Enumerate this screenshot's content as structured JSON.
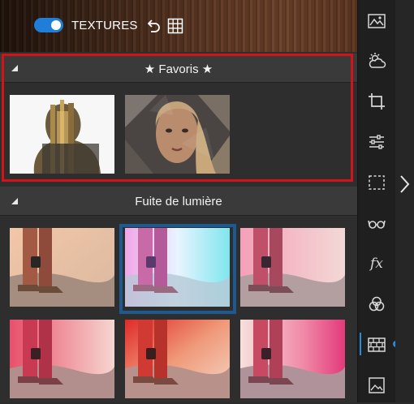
{
  "header": {
    "toggle_on": true,
    "title": "TEXTURES",
    "icons": [
      "undo-icon",
      "grid-icon"
    ]
  },
  "sections": {
    "favorites": {
      "title": "★ Favoris ★",
      "items": [
        {
          "name": "double-exposure-forest-man"
        },
        {
          "name": "geometric-triangle-portrait"
        }
      ]
    },
    "light_leak": {
      "title": "Fuite de lumière",
      "items": [
        {
          "name": "light-leak-warm-peach"
        },
        {
          "name": "light-leak-cyan-magenta",
          "selected": true
        },
        {
          "name": "light-leak-pink-haze"
        },
        {
          "name": "light-leak-red-pink"
        },
        {
          "name": "light-leak-red-orange"
        },
        {
          "name": "light-leak-magenta-pink"
        }
      ]
    }
  },
  "toolbar": {
    "tools": [
      "landscape-photo-icon",
      "weather-sun-cloud-icon",
      "crop-icon",
      "adjust-sliders-icon",
      "selection-marquee-icon",
      "glasses-icon",
      "fx-icon",
      "color-circles-icon",
      "texture-brick-icon",
      "image-frame-icon"
    ],
    "fx_label": "fx",
    "active": "texture-brick-icon"
  },
  "colors": {
    "accent": "#1e7ed8",
    "highlight_outline": "#d0141a",
    "selected_frame": "#1d5a91"
  }
}
